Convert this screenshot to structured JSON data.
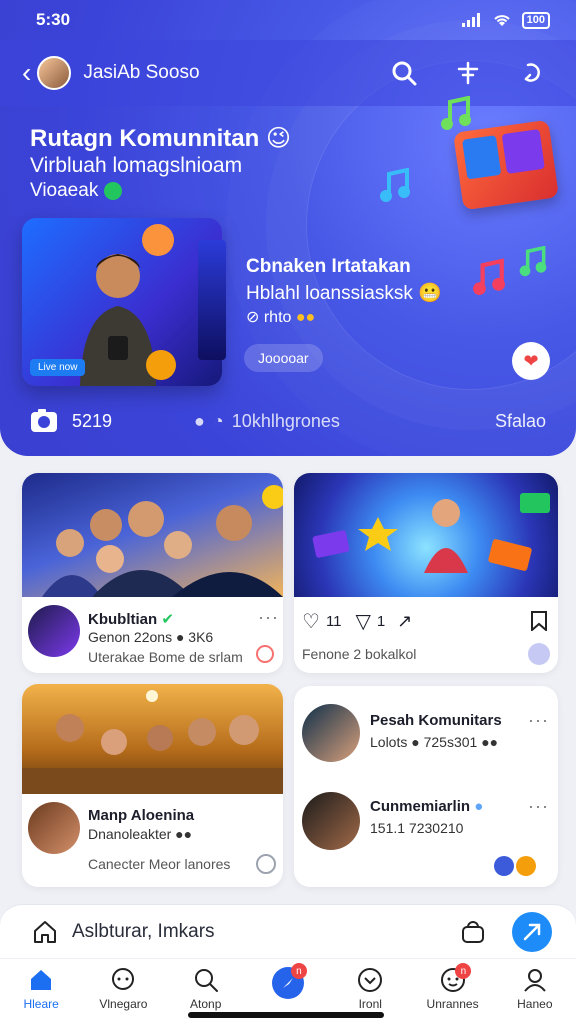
{
  "status": {
    "time": "5:30",
    "battery": "100"
  },
  "topbar": {
    "title": "JasiAb Sooso"
  },
  "hero": {
    "title": "Rutagn Komunnitan",
    "sub1": "Virbluah lomagslnioam",
    "sub2": "Vioaeak",
    "image_tag": "Live now",
    "feature": {
      "title": "Cbnaken Irtatakan",
      "subtitle": "Hblahl loanssiasksk",
      "meta": "⊘ rhto",
      "button": "Jooooar"
    },
    "stats": {
      "count": "5219",
      "middle": "10khlhgrones",
      "end": "Sfalao"
    }
  },
  "cards": {
    "c1": {
      "name": "Kbubltian",
      "line1": "Genon 22ons ● 3K6",
      "footer": "Uterakae Bome de srlam"
    },
    "c2": {
      "likes": "11",
      "comments": "1",
      "footer": "Fenone 2 bokalkol"
    },
    "c3": {
      "name": "Manp Aloenina",
      "line1": "Dnanoleakter ●●",
      "footer": "Canecter Meor lanores"
    },
    "c4": {
      "item1": {
        "name": "Pesah Komunitars",
        "line1": "Lolots ● 725s301 ●●"
      },
      "item2": {
        "name": "Cunmemiarlin",
        "line1": "151.1 7230210"
      }
    }
  },
  "compose": {
    "label": "Aslbturar, Imkars"
  },
  "tabs": [
    {
      "label": "Hleare",
      "icon": "home-icon",
      "badge": ""
    },
    {
      "label": "Vlnegaro",
      "icon": "chat-icon",
      "badge": ""
    },
    {
      "label": "Atonp",
      "icon": "search-icon",
      "badge": ""
    },
    {
      "label": "",
      "icon": "compass-icon",
      "badge": "n"
    },
    {
      "label": "Ironl",
      "icon": "heart-icon",
      "badge": ""
    },
    {
      "label": "Unrannes",
      "icon": "message-icon",
      "badge": "n"
    },
    {
      "label": "Haneo",
      "icon": "profile-icon",
      "badge": ""
    }
  ],
  "colors": {
    "hero": "#3b44d8",
    "accent": "#1d8cf8",
    "active_tab": "#1d6ff2"
  }
}
